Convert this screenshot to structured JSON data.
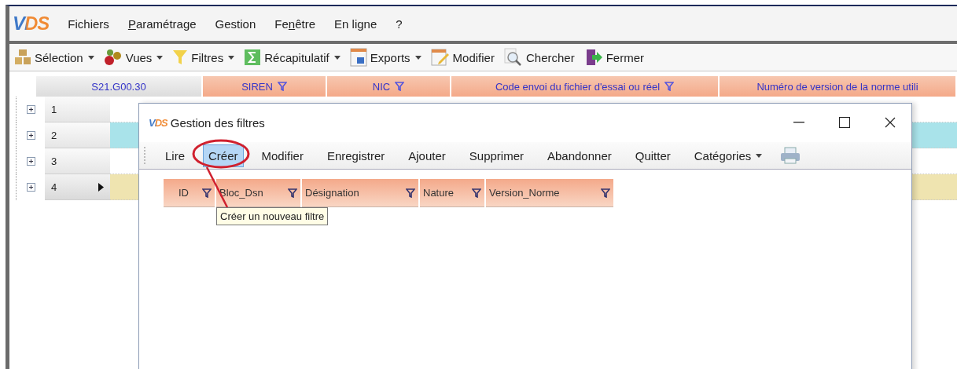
{
  "app": {
    "logo": "VDS"
  },
  "menu": [
    {
      "pre": "Fichiers"
    },
    {
      "key": "P",
      "post": "aramétrage"
    },
    {
      "pre": "Gestion"
    },
    {
      "pre": "Fe",
      "key": "n",
      "post": "être"
    },
    {
      "pre": "En ligne"
    },
    {
      "pre": "?"
    }
  ],
  "toolbar": [
    {
      "label": "Sélection",
      "dropdown": true
    },
    {
      "label": "Vues",
      "dropdown": true
    },
    {
      "label": "Filtres",
      "dropdown": true
    },
    {
      "label": "Récapitulatif",
      "dropdown": true
    },
    {
      "label": "Exports",
      "dropdown": true
    },
    {
      "label": "Modifier",
      "dropdown": false
    },
    {
      "label": "Chercher",
      "dropdown": false
    },
    {
      "label": "Fermer",
      "dropdown": false
    }
  ],
  "grid": {
    "columns": [
      {
        "label": "S21.G00.30",
        "filter": false
      },
      {
        "label": "SIREN",
        "filter": true
      },
      {
        "label": "NIC",
        "filter": true
      },
      {
        "label": "Code envoi du fichier d'essai ou réel",
        "filter": true
      },
      {
        "label": "Numéro de version de la norme utili",
        "filter": false
      }
    ],
    "rows": [
      {
        "label": "1",
        "color": "#ffffff",
        "selected": false
      },
      {
        "label": "2",
        "color": "#a9e3ea",
        "selected": false
      },
      {
        "label": "3",
        "color": "#ffffff",
        "selected": false
      },
      {
        "label": "4",
        "color": "#efe4b0",
        "selected": true
      }
    ]
  },
  "dialog": {
    "logo": "VDS",
    "title": "Gestion des filtres",
    "toolbar": [
      {
        "label": "Lire",
        "selected": false,
        "dropdown": false
      },
      {
        "label": "Créer",
        "selected": true,
        "dropdown": false
      },
      {
        "label": "Modifier",
        "selected": false,
        "dropdown": false
      },
      {
        "label": "Enregistrer",
        "selected": false,
        "dropdown": false
      },
      {
        "label": "Ajouter",
        "selected": false,
        "dropdown": false
      },
      {
        "label": "Supprimer",
        "selected": false,
        "dropdown": false
      },
      {
        "label": "Abandonner",
        "selected": false,
        "dropdown": false
      },
      {
        "label": "Quitter",
        "selected": false,
        "dropdown": false
      },
      {
        "label": "Catégories",
        "selected": false,
        "dropdown": true
      }
    ],
    "columns": [
      {
        "label": "ID",
        "filter": true
      },
      {
        "label": "Bloc_Dsn",
        "filter": true
      },
      {
        "label": "Désignation",
        "filter": true
      },
      {
        "label": "Nature",
        "filter": true
      },
      {
        "label": "Version_Norme",
        "filter": true
      }
    ],
    "tooltip": "Créer un nouveau filtre"
  }
}
